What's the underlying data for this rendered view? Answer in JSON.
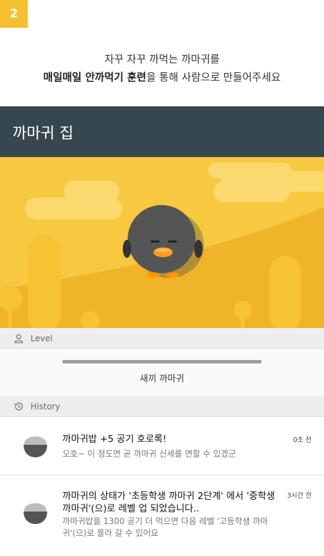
{
  "step": {
    "number": "2"
  },
  "tagline": {
    "line1": "자꾸 자꾸 까먹는 까마귀를",
    "line2_bold": "매일매일 안까먹기 훈련",
    "line2_rest": "을 통해 사람으로 만들어주세요"
  },
  "appbar": {
    "title": "까마귀 집"
  },
  "level": {
    "header_label": "Level",
    "header_icon": "person-icon",
    "progress_fraction": 1.0,
    "name": "새끼 까마귀"
  },
  "history": {
    "header_label": "History",
    "header_icon": "history-icon",
    "items": [
      {
        "icon": "rice-bowl-icon",
        "title": "까마귀밥 +5 공기 호로록!",
        "body": "오호~ 이 정도면 곧 까마귀 신세를 면할 수 있겠군",
        "time": "0초 전"
      },
      {
        "icon": "rice-bowl-icon",
        "title_line1": "까마귀의 상태가 '초등학생 까마귀 2단계' 에서 '중학생",
        "title_line2": "까마귀'(으)로 레벨 업 되었습니다..",
        "body_line1": "까마귀밥을 1300 공기 더 먹으면 다음 레벨 '고등학생 까마",
        "body_line2": "귀'(으)로 올라 갈 수 있어요",
        "time": "3시간 전"
      }
    ]
  },
  "colors": {
    "step_badge": "#f4c02f",
    "appbar": "#37474f",
    "scene_sky": "#f6c940",
    "scene_hill": "#f0b42a",
    "crow_body": "#555555",
    "crow_beak": "#ff9800"
  }
}
